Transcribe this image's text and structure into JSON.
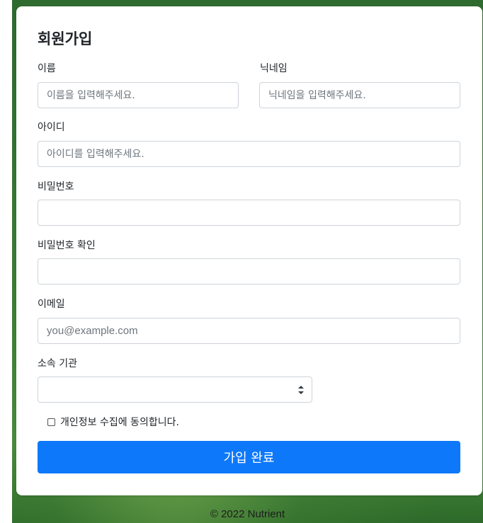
{
  "form": {
    "title": "회원가입",
    "name": {
      "label": "이름",
      "placeholder": "이름을 입력해주세요."
    },
    "nickname": {
      "label": "닉네임",
      "placeholder": "닉네임을 입력해주세요."
    },
    "user_id": {
      "label": "아이디",
      "placeholder": "아이디를 입력해주세요."
    },
    "password": {
      "label": "비밀번호",
      "placeholder": ""
    },
    "password_confirm": {
      "label": "비밀번호 확인",
      "placeholder": ""
    },
    "email": {
      "label": "이메일",
      "placeholder": "you@example.com"
    },
    "affiliation": {
      "label": "소속 기관",
      "selected": ""
    },
    "privacy_consent": {
      "label": "개인정보 수집에 동의합니다.",
      "checked": false
    },
    "submit_label": "가입 완료"
  },
  "footer": {
    "text": "© 2022 Nutrient"
  },
  "colors": {
    "primary": "#0d78f9",
    "background_green": "#3c7b35",
    "input_border": "#ced4da"
  }
}
